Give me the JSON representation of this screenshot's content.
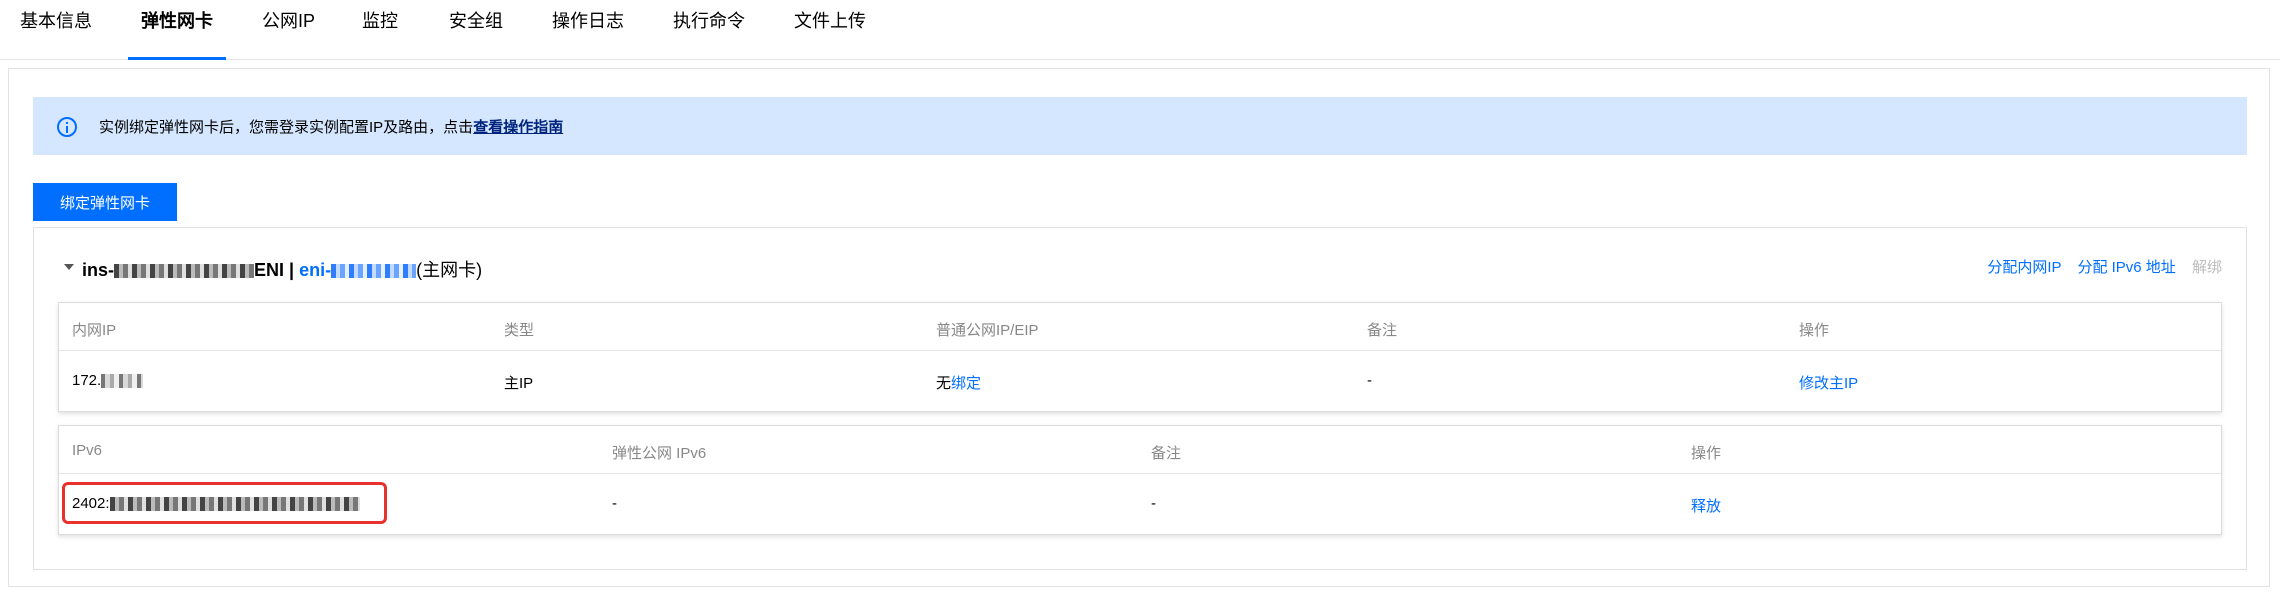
{
  "tabs": [
    {
      "label": "基本信息",
      "active": false
    },
    {
      "label": "弹性网卡",
      "active": true
    },
    {
      "label": "公网IP",
      "active": false
    },
    {
      "label": "监控",
      "active": false
    },
    {
      "label": "安全组",
      "active": false
    },
    {
      "label": "操作日志",
      "active": false
    },
    {
      "label": "执行命令",
      "active": false
    },
    {
      "label": "文件上传",
      "active": false
    }
  ],
  "banner": {
    "icon": "info-icon",
    "text": "实例绑定弹性网卡后，您需登录实例配置IP及路由，点击",
    "link": "查看操作指南"
  },
  "bind_button": "绑定弹性网卡",
  "eni": {
    "title_prefix": "ins-",
    "title_mid": "ENI |",
    "eni_prefix": "eni-",
    "main_tag": "(主网卡)",
    "actions": {
      "assign_private_ip": "分配内网IP",
      "assign_ipv6": "分配 IPv6 地址",
      "unbind": "解绑"
    }
  },
  "ipv4_table": {
    "headers": [
      "内网IP",
      "类型",
      "普通公网IP/EIP",
      "备注",
      "操作"
    ],
    "row": {
      "private_ip": "172.",
      "type": "主IP",
      "public_ip_none": "无",
      "public_ip_bind": "绑定",
      "remark": "-",
      "action": "修改主IP"
    }
  },
  "ipv6_table": {
    "headers": [
      "IPv6",
      "弹性公网 IPv6",
      "备注",
      "操作"
    ],
    "row": {
      "ipv6": "2402:",
      "eip6": "-",
      "remark": "-",
      "action": "释放"
    }
  },
  "colors": {
    "accent": "#006eff",
    "banner_bg": "#d5e7ff",
    "highlight": "#e8312b"
  }
}
